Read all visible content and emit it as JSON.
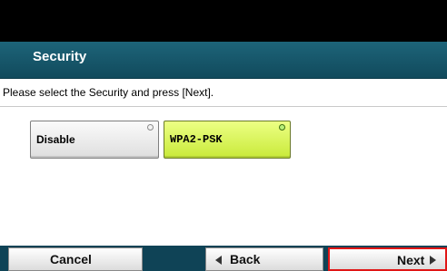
{
  "header": {
    "title": "Security"
  },
  "instruction": "Please select the Security and press [Next].",
  "options": [
    {
      "label": "Disable",
      "selected": false
    },
    {
      "label": "WPA2-PSK",
      "selected": true
    }
  ],
  "footer": {
    "cancel_label": "Cancel",
    "back_label": "Back",
    "next_label": "Next"
  },
  "colors": {
    "header_bg": "#1b5f73",
    "selected_bg": "#d6f24a",
    "highlight_border": "#e01616"
  }
}
